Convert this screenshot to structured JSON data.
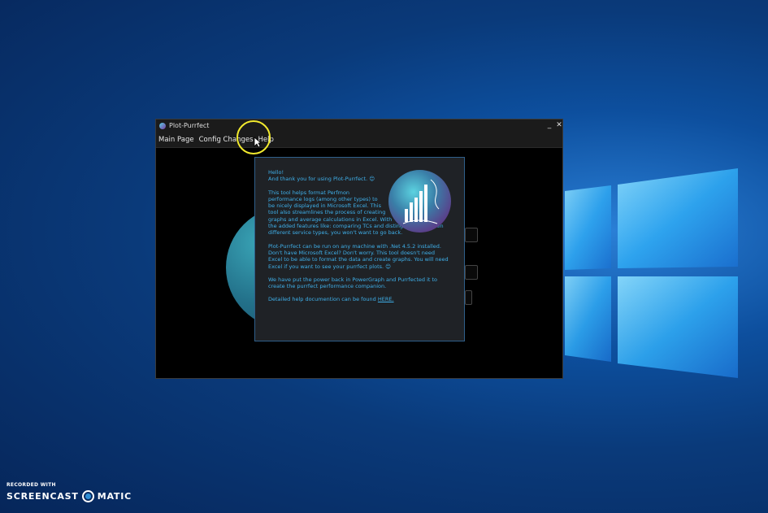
{
  "window": {
    "title": "Plot-Purrfect",
    "minimize": "_",
    "close": "✕"
  },
  "menu": {
    "items": [
      "Main Page",
      "Config Changes",
      "Help"
    ]
  },
  "help_popup": {
    "greeting": "Hello!",
    "thanks": "And thank you for using Plot-Purrfect. 😊",
    "para1": [
      "This tool helps format Perfmon",
      "performance logs (among other types) to",
      "be nicely displayed in Microsoft Excel. This",
      "tool also streamlines the process of creating",
      "graphs and average calculations in Excel.  With",
      "the added features like: comparing TCs and distinguising between",
      "different service types, you won't want to go back."
    ],
    "para2": [
      "Plot-Purrfect can be run on any machine with .Net 4.5.2 installed.",
      "Don't have Microsoft Excel? Don't worry. This tool doesn't need",
      "Excel to be able to format the data and create graphs. You will need",
      "Excel if you want to see your purrfect plots. 😊"
    ],
    "para3": [
      "We have put the power back in PowerGraph and Purrfected it to",
      "create the purrfect performance companion."
    ],
    "doc_prefix": "Detailed help documention can be found",
    "doc_link": "HERE."
  },
  "watermark": {
    "small": "RECORDED WITH",
    "left": "SCREENCAST",
    "right": "MATIC"
  },
  "colors": {
    "help_text": "#3fb0ea",
    "cursor_highlight": "#f2ea2e",
    "desktop": "#0a3a7a"
  }
}
